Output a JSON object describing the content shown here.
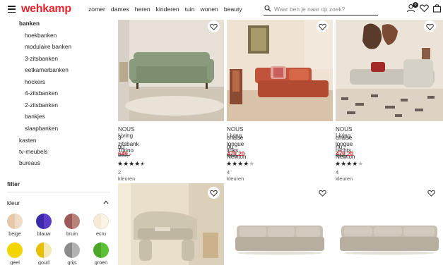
{
  "header": {
    "logo": "wehkamp",
    "nav": [
      "zomer",
      "dames",
      "heren",
      "kinderen",
      "tuin",
      "wonen",
      "beauty"
    ],
    "search_placeholder": "Waar ben je naar op zoek?",
    "cart_badge": "0",
    "colors": {
      "logo": "#e5262f"
    }
  },
  "sidebar": {
    "active_category": "banken",
    "subcategories": [
      "hoekbanken",
      "modulaire banken",
      "3-zitsbanken",
      "eetkamerbanken",
      "hockers",
      "4-zitsbanken",
      "2-zitsbanken",
      "bankjes",
      "slaapbanken"
    ],
    "categories": [
      "kasten",
      "tv-meubels",
      "bureaus"
    ],
    "filter_title": "filter",
    "color_filter_label": "kleur",
    "color_swatches": [
      {
        "label": "beige",
        "left": "#e8c8a8",
        "right": "#efdcc6"
      },
      {
        "label": "blauw",
        "left": "#3a2aa8",
        "right": "#5a3cc8"
      },
      {
        "label": "bruin",
        "left": "#9b5a58",
        "right": "#b88278"
      },
      {
        "label": "ecru",
        "left": "#f6ead6",
        "right": "#fbf3e4"
      },
      {
        "label": "geel",
        "left": "#f3d500",
        "right": "#f3d500"
      },
      {
        "label": "goud",
        "left": "#e6c000",
        "right": "#f4e9b0"
      },
      {
        "label": "grijs",
        "left": "#8a8a8a",
        "right": "#b2b2b2"
      },
      {
        "label": "groen",
        "left": "#4aa72a",
        "right": "#5bc236"
      }
    ]
  },
  "products": [
    {
      "brand": "NOUS Living",
      "name": "3-zitsbank Torino",
      "price_prefix": "nu",
      "price": "649,-",
      "old_price": "699,-",
      "rating": 4.5,
      "colors": "2 kleuren"
    },
    {
      "brand": "NOUS Living",
      "name": "chaise longue links Newton",
      "price_prefix": "nu",
      "price": "479,20",
      "old_price": "599,-",
      "rating": 4,
      "colors": "4 kleuren"
    },
    {
      "brand": "NOUS Living",
      "name": "chaise longue rechts Newton",
      "price_prefix": "nu",
      "price": "479,20",
      "old_price": "599,-",
      "rating": 4,
      "colors": "4 kleuren"
    },
    {
      "brand": "",
      "name": "",
      "price_prefix": "",
      "price": "",
      "old_price": "",
      "colors": ""
    },
    {
      "brand": "",
      "name": "",
      "price_prefix": "",
      "price": "",
      "old_price": "",
      "colors": ""
    },
    {
      "brand": "",
      "name": "",
      "price_prefix": "",
      "price": "",
      "old_price": "",
      "colors": ""
    }
  ]
}
